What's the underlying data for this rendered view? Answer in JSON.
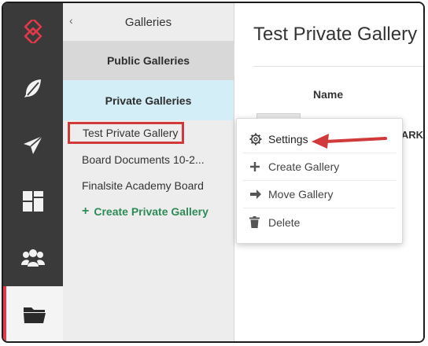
{
  "rail": {
    "items": [
      {
        "name": "logo-icon"
      },
      {
        "name": "feather-icon"
      },
      {
        "name": "paper-plane-icon"
      },
      {
        "name": "dashboard-icon"
      },
      {
        "name": "users-icon"
      },
      {
        "name": "folder-icon",
        "active": true
      }
    ],
    "accent_color": "#e0394b"
  },
  "panel": {
    "title": "Galleries",
    "back_glyph": "‹",
    "tabs": {
      "public": "Public Galleries",
      "private": "Private Galleries"
    },
    "galleries": [
      {
        "label": "Test Private Gallery",
        "highlighted": true
      },
      {
        "label": "Board Documents 10-2..."
      },
      {
        "label": "Finalsite Academy Board"
      }
    ],
    "create_label": "Create Private Gallery",
    "create_color": "#2e8b57"
  },
  "main": {
    "title": "Test Private Gallery",
    "column_name": "Name",
    "truncated_text": "KARK"
  },
  "context_menu": {
    "items": [
      {
        "label": "Settings",
        "icon": "gear-icon"
      },
      {
        "label": "Create Gallery",
        "icon": "plus-icon"
      },
      {
        "label": "Move Gallery",
        "icon": "arrow-right-icon"
      },
      {
        "label": "Delete",
        "icon": "trash-icon"
      }
    ]
  },
  "annotation": {
    "color": "#d03a3a"
  }
}
